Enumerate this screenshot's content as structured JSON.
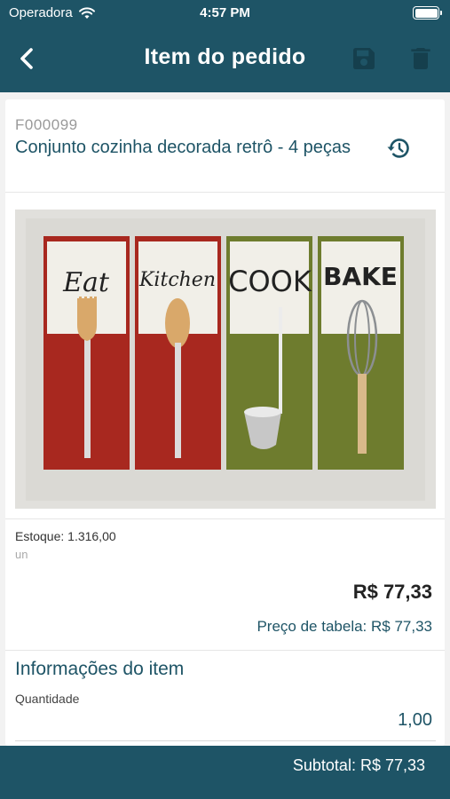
{
  "status_bar": {
    "carrier": "Operadora",
    "time": "4:57 PM",
    "wifi_icon": "wifi-icon",
    "battery_icon": "battery-icon",
    "battery_level": 1.0
  },
  "navbar": {
    "title": "Item do pedido",
    "back_icon": "chevron-left-icon",
    "save_icon": "floppy-disk-icon",
    "delete_icon": "trash-icon"
  },
  "item": {
    "code": "F000099",
    "name": "Conjunto cozinha decorada retrô - 4 peças",
    "history_icon": "history-icon",
    "image_words": [
      "Eat",
      "Kitchen",
      "COOK",
      "BAKE"
    ]
  },
  "stock": {
    "label": "Estoque: 1.316,00",
    "unit": "un"
  },
  "pricing": {
    "price": "R$ 77,33",
    "table_price": "Preço de tabela: R$ 77,33"
  },
  "info": {
    "section_title": "Informações do item",
    "quantity_label": "Quantidade",
    "quantity_value": "1,00"
  },
  "footer": {
    "subtotal": "Subtotal: R$ 77,33"
  },
  "colors": {
    "primary": "#1e5466",
    "panel_red": "#a8281f",
    "panel_green": "#6e7c2e"
  }
}
